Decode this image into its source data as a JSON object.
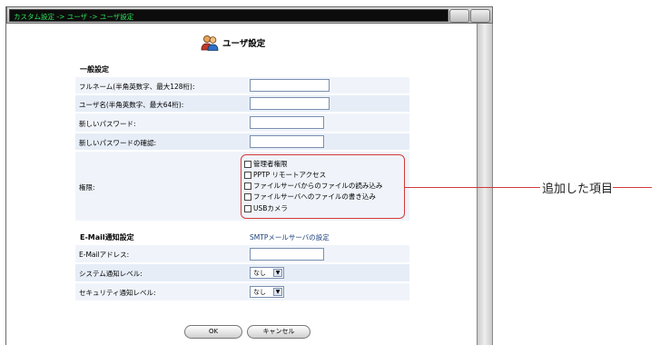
{
  "window": {
    "breadcrumb": "カスタム設定 -> ユーザ -> ユーザ設定"
  },
  "page": {
    "title": "ユーザ設定",
    "icon": "users-icon"
  },
  "general": {
    "section_title": "一般設定",
    "fullname_label": "フルネーム(半角英数字、最大128桁):",
    "fullname_value": "",
    "username_label": "ユーザ名(半角英数字、最大64桁):",
    "username_value": "",
    "password_label": "新しいパスワード:",
    "password_value": "",
    "password_confirm_label": "新しいパスワードの確認:",
    "password_confirm_value": "",
    "permissions_label": "権限:",
    "permissions": [
      {
        "label": "管理者権限",
        "checked": false
      },
      {
        "label": "PPTP リモートアクセス",
        "checked": false
      },
      {
        "label": "ファイルサーバからのファイルの読み込み",
        "checked": false
      },
      {
        "label": "ファイルサーバへのファイルの書き込み",
        "checked": false
      },
      {
        "label": "USBカメラ",
        "checked": false
      }
    ]
  },
  "email": {
    "section_title": "E-Mail通知設定",
    "smtp_link": "SMTPメールサーバの設定",
    "address_label": "E-Mailアドレス:",
    "address_value": "",
    "system_level_label": "システム通知レベル:",
    "system_level_value": "なし",
    "security_level_label": "セキュリティ通知レベル:",
    "security_level_value": "なし"
  },
  "buttons": {
    "ok": "OK",
    "cancel": "キャンセル"
  },
  "annotation": {
    "text": "追加した項目",
    "color": "#d53a3a"
  }
}
